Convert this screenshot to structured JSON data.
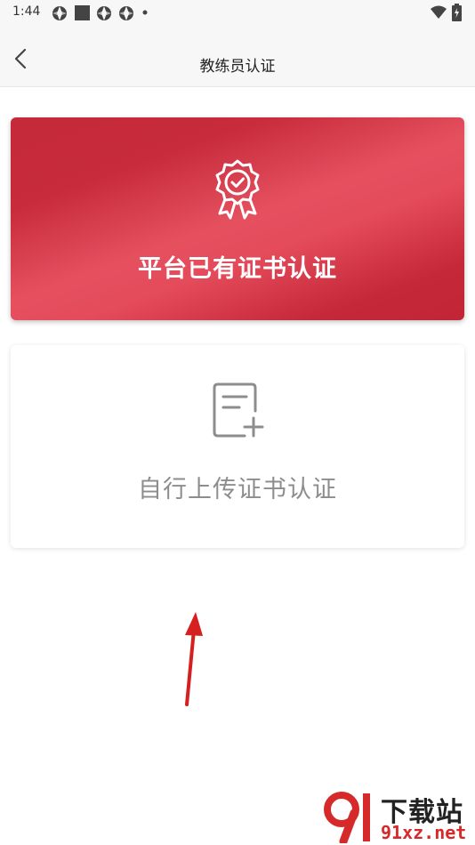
{
  "status_bar": {
    "time": "1:44",
    "left_icons": [
      "aperture-icon",
      "square-icon",
      "aperture-icon",
      "aperture-icon",
      "dot-icon"
    ],
    "right_icons": [
      "wifi-icon",
      "battery-icon"
    ]
  },
  "nav": {
    "title": "教练员认证",
    "back_icon": "chevron-left-icon"
  },
  "cards": {
    "platform": {
      "label": "平台已有证书认证",
      "icon": "award-badge-icon",
      "gradient": [
        "#c42a3a",
        "#e5505f",
        "#c22636"
      ]
    },
    "upload": {
      "label": "自行上传证书认证",
      "icon": "document-add-icon",
      "color": "#8d8d8d"
    }
  },
  "annotation": {
    "icon": "red-arrow-icon",
    "color": "#d62020"
  },
  "watermark": {
    "text_cn": "下载站",
    "text_url": "91xz.net",
    "logo_icon": "91-logo-icon"
  }
}
